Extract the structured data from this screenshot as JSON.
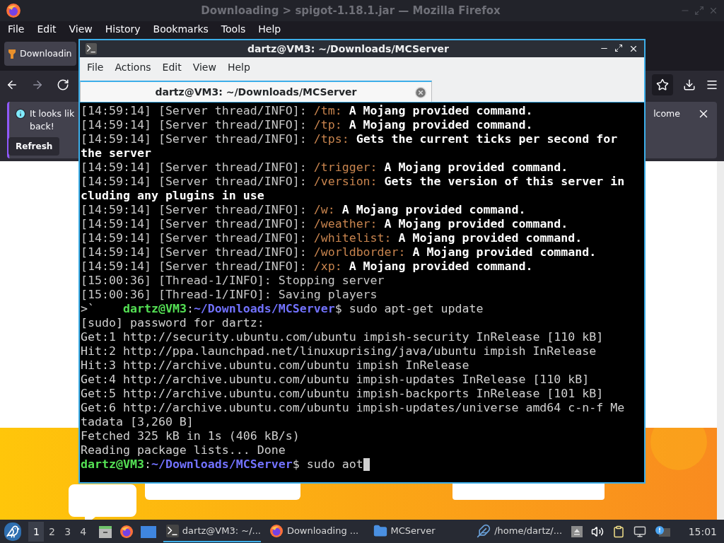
{
  "firefox": {
    "title": "Downloading > spigot-1.18.1.jar — Mozilla Firefox",
    "menu": [
      "File",
      "Edit",
      "View",
      "History",
      "Bookmarks",
      "Tools",
      "Help"
    ],
    "tab": {
      "label": "Downloadin"
    },
    "notification": {
      "line_1": "It looks lik",
      "line_2": "back!",
      "button": "Refresh",
      "right_text": "lcome"
    }
  },
  "terminal": {
    "title": "dartz@VM3: ~/Downloads/MCServer",
    "menu": [
      "File",
      "Actions",
      "Edit",
      "View",
      "Help"
    ],
    "tab": {
      "label": "dartz@VM3: ~/Downloads/MCServer"
    },
    "lines": [
      {
        "segments": [
          {
            "kind": "dim",
            "text": "[14:59:14] [Server thread/INFO]: "
          },
          {
            "kind": "cmd",
            "text": "/tm: "
          },
          {
            "kind": "bold",
            "text": "A Mojang provided command."
          }
        ]
      },
      {
        "segments": [
          {
            "kind": "dim",
            "text": "[14:59:14] [Server thread/INFO]: "
          },
          {
            "kind": "cmd",
            "text": "/tp: "
          },
          {
            "kind": "bold",
            "text": "A Mojang provided command."
          }
        ]
      },
      {
        "segments": [
          {
            "kind": "dim",
            "text": "[14:59:14] [Server thread/INFO]: "
          },
          {
            "kind": "cmd",
            "text": "/tps: "
          },
          {
            "kind": "bold",
            "text": "Gets the current ticks per second for"
          }
        ]
      },
      {
        "segments": [
          {
            "kind": "bold",
            "text": "the server"
          }
        ]
      },
      {
        "segments": [
          {
            "kind": "dim",
            "text": "[14:59:14] [Server thread/INFO]: "
          },
          {
            "kind": "cmd",
            "text": "/trigger: "
          },
          {
            "kind": "bold",
            "text": "A Mojang provided command."
          }
        ]
      },
      {
        "segments": [
          {
            "kind": "dim",
            "text": "[14:59:14] [Server thread/INFO]: "
          },
          {
            "kind": "cmd",
            "text": "/version: "
          },
          {
            "kind": "bold",
            "text": "Gets the version of this server in"
          }
        ]
      },
      {
        "segments": [
          {
            "kind": "bold",
            "text": "cluding any plugins in use"
          }
        ]
      },
      {
        "segments": [
          {
            "kind": "dim",
            "text": "[14:59:14] [Server thread/INFO]: "
          },
          {
            "kind": "cmd",
            "text": "/w: "
          },
          {
            "kind": "bold",
            "text": "A Mojang provided command."
          }
        ]
      },
      {
        "segments": [
          {
            "kind": "dim",
            "text": "[14:59:14] [Server thread/INFO]: "
          },
          {
            "kind": "cmd",
            "text": "/weather: "
          },
          {
            "kind": "bold",
            "text": "A Mojang provided command."
          }
        ]
      },
      {
        "segments": [
          {
            "kind": "dim",
            "text": "[14:59:14] [Server thread/INFO]: "
          },
          {
            "kind": "cmd",
            "text": "/whitelist: "
          },
          {
            "kind": "bold",
            "text": "A Mojang provided command."
          }
        ]
      },
      {
        "segments": [
          {
            "kind": "dim",
            "text": "[14:59:14] [Server thread/INFO]: "
          },
          {
            "kind": "cmd",
            "text": "/worldborder: "
          },
          {
            "kind": "bold",
            "text": "A Mojang provided command."
          }
        ]
      },
      {
        "segments": [
          {
            "kind": "dim",
            "text": "[14:59:14] [Server thread/INFO]: "
          },
          {
            "kind": "cmd",
            "text": "/xp: "
          },
          {
            "kind": "bold",
            "text": "A Mojang provided command."
          }
        ]
      },
      {
        "segments": [
          {
            "kind": "dim",
            "text": "[15:00:36] [Thread-1/INFO]: Stopping server"
          }
        ]
      },
      {
        "segments": [
          {
            "kind": "dim",
            "text": "[15:00:36] [Thread-1/INFO]: Saving players"
          }
        ]
      },
      {
        "segments": [
          {
            "kind": "text",
            "text": ">`    "
          },
          {
            "kind": "user",
            "text": "dartz@VM3"
          },
          {
            "kind": "text",
            "text": ":"
          },
          {
            "kind": "path",
            "text": "~/Downloads/MCServer"
          },
          {
            "kind": "text",
            "text": "$ sudo apt-get update"
          }
        ]
      },
      {
        "segments": [
          {
            "kind": "text",
            "text": "[sudo] password for dartz:"
          }
        ]
      },
      {
        "segments": [
          {
            "kind": "text",
            "text": "Get:1 http://security.ubuntu.com/ubuntu impish-security InRelease [110 kB]"
          }
        ]
      },
      {
        "segments": [
          {
            "kind": "text",
            "text": "Hit:2 http://ppa.launchpad.net/linuxuprising/java/ubuntu impish InRelease"
          }
        ]
      },
      {
        "segments": [
          {
            "kind": "text",
            "text": "Hit:3 http://archive.ubuntu.com/ubuntu impish InRelease"
          }
        ]
      },
      {
        "segments": [
          {
            "kind": "text",
            "text": "Get:4 http://archive.ubuntu.com/ubuntu impish-updates InRelease [110 kB]"
          }
        ]
      },
      {
        "segments": [
          {
            "kind": "text",
            "text": "Get:5 http://archive.ubuntu.com/ubuntu impish-backports InRelease [101 kB]"
          }
        ]
      },
      {
        "segments": [
          {
            "kind": "text",
            "text": "Get:6 http://archive.ubuntu.com/ubuntu impish-updates/universe amd64 c-n-f Me"
          }
        ]
      },
      {
        "segments": [
          {
            "kind": "text",
            "text": "tadata [3,260 B]"
          }
        ]
      },
      {
        "segments": [
          {
            "kind": "text",
            "text": "Fetched 325 kB in 1s (406 kB/s)"
          }
        ]
      },
      {
        "segments": [
          {
            "kind": "text",
            "text": "Reading package lists... Done"
          }
        ]
      },
      {
        "segments": [
          {
            "kind": "user",
            "text": "dartz@VM3"
          },
          {
            "kind": "text",
            "text": ":"
          },
          {
            "kind": "path",
            "text": "~/Downloads/MCServer"
          },
          {
            "kind": "text",
            "text": "$ sudo aot"
          }
        ]
      }
    ],
    "cursor": true
  },
  "taskbar": {
    "workspaces": [
      {
        "label": "1",
        "selected": true
      },
      {
        "label": "2",
        "selected": false
      },
      {
        "label": "3",
        "selected": false
      },
      {
        "label": "4",
        "selected": false
      }
    ],
    "tasks": [
      {
        "kind": "terminal",
        "label": "dartz@VM3: ~/...",
        "selected": true
      },
      {
        "kind": "browser",
        "label": "Downloading ...",
        "selected": false
      },
      {
        "kind": "folder",
        "label": "MCServer",
        "selected": false
      },
      {
        "kind": "editor",
        "label": "/home/dartz/...",
        "selected": false
      }
    ],
    "clock": "15:01"
  }
}
